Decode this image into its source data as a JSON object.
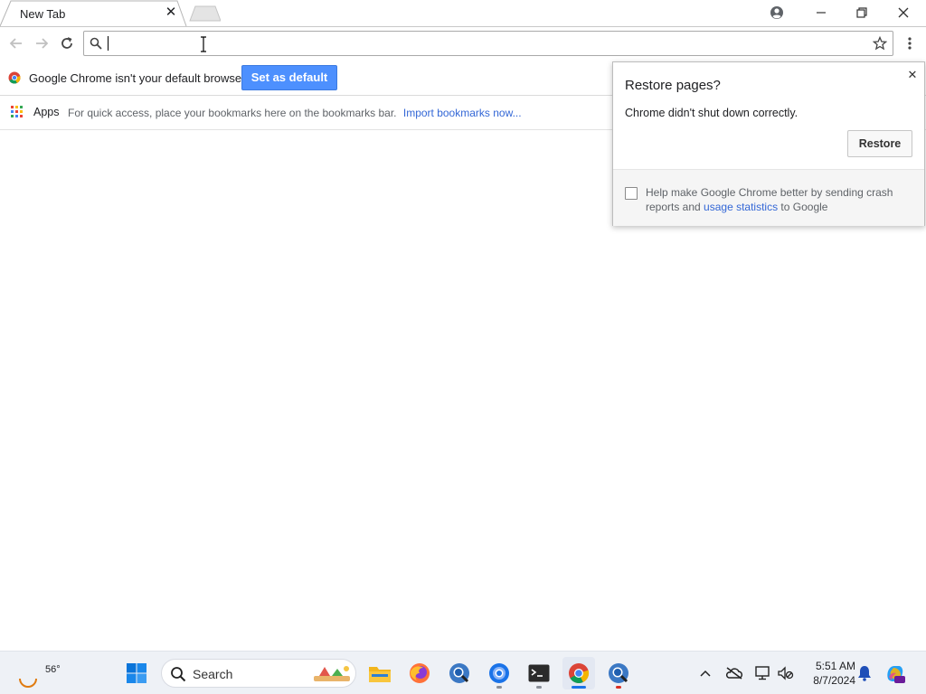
{
  "tab": {
    "title": "New Tab",
    "close_glyph": "✕"
  },
  "window_controls": {
    "profile": "profile-icon",
    "minimize": "minimize-icon",
    "restore": "restore-icon",
    "close": "close-icon"
  },
  "omnibox": {
    "value": "",
    "placeholder": ""
  },
  "infobar": {
    "message": "Google Chrome isn't your default browser.",
    "button_label": "Set as default"
  },
  "bookmarks": {
    "apps_label": "Apps",
    "hint": "For quick access, place your bookmarks here on the bookmarks bar.",
    "import_link": "Import bookmarks now..."
  },
  "restore_popup": {
    "title": "Restore pages?",
    "message": "Chrome didn't shut down correctly.",
    "button_label": "Restore",
    "footer_prefix": "Help make Google Chrome better by sending crash reports and ",
    "footer_link": "usage statistics",
    "footer_suffix": " to Google",
    "close_glyph": "✕"
  },
  "taskbar": {
    "weather_temp": "56°",
    "search_label": "Search",
    "apps": [
      "start-icon",
      "file-explorer-icon",
      "firefox-icon",
      "chrome-app-icon",
      "chrome-canary-icon",
      "terminal-icon",
      "chrome-icon",
      "chrome-app-icon"
    ],
    "time": "5:51 AM",
    "date": "8/7/2024"
  },
  "colors": {
    "accent": "#4d90fe",
    "link": "#3367d6",
    "taskbar_bg": "#eef1f6"
  }
}
